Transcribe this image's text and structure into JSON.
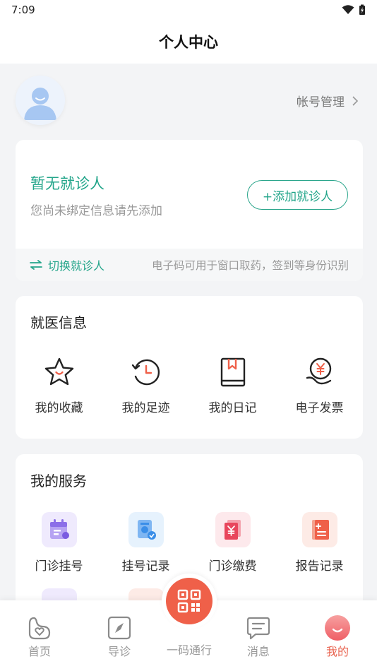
{
  "status_bar": {
    "time": "7:09"
  },
  "header": {
    "title": "个人中心"
  },
  "profile": {
    "account_label": "帐号管理"
  },
  "patient": {
    "title": "暂无就诊人",
    "hint": "您尚未绑定信息请先添加",
    "add_button": "+添加就诊人",
    "switch_label": "切换就诊人",
    "ecode_hint": "电子码可用于窗口取药，签到等身份识别"
  },
  "medical": {
    "title": "就医信息",
    "items": [
      {
        "label": "我的收藏",
        "icon": "star-icon"
      },
      {
        "label": "我的足迹",
        "icon": "history-clock-icon"
      },
      {
        "label": "我的日记",
        "icon": "diary-book-icon"
      },
      {
        "label": "电子发票",
        "icon": "invoice-yen-icon"
      }
    ]
  },
  "services": {
    "title": "我的服务",
    "items": [
      {
        "label": "门诊挂号",
        "icon": "calendar-icon",
        "color": "#8b6fe8"
      },
      {
        "label": "挂号记录",
        "icon": "register-record-icon",
        "color": "#3a8ee8"
      },
      {
        "label": "门诊缴费",
        "icon": "payment-icon",
        "color": "#e8465c"
      },
      {
        "label": "报告记录",
        "icon": "report-icon",
        "color": "#ef6049"
      }
    ]
  },
  "tabbar": {
    "items": [
      {
        "label": "首页",
        "icon": "home-heart-icon"
      },
      {
        "label": "导诊",
        "icon": "compass-icon"
      },
      {
        "label": "一码通行",
        "icon": "qr-code-icon"
      },
      {
        "label": "消息",
        "icon": "message-icon"
      },
      {
        "label": "我的",
        "icon": "profile-icon",
        "active": true
      }
    ]
  },
  "colors": {
    "primary": "#23a58a",
    "accent": "#ef6049",
    "background": "#f3f4f6"
  }
}
